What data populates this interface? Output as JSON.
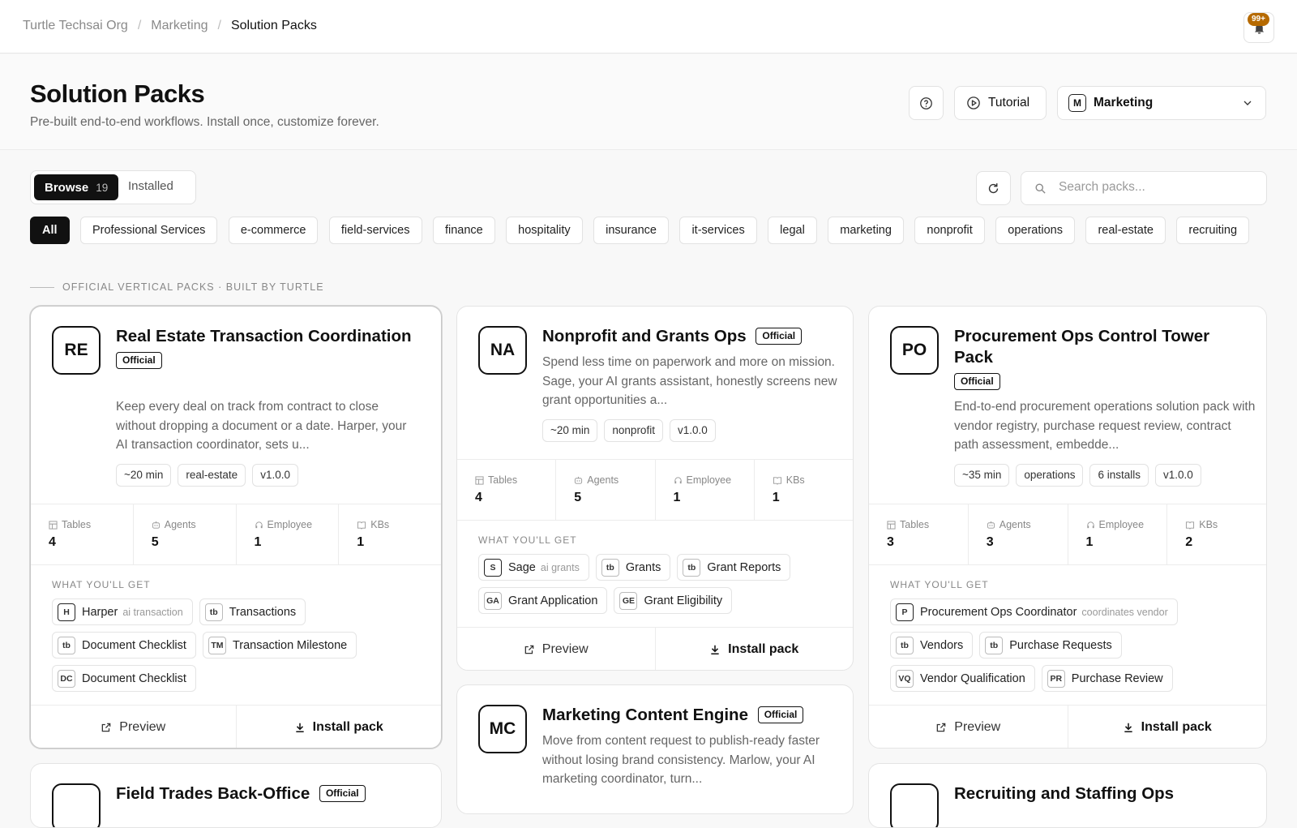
{
  "breadcrumb": [
    "Turtle Techsai Org",
    "Marketing",
    "Solution Packs"
  ],
  "notifications": {
    "badge": "99+"
  },
  "header": {
    "title": "Solution Packs",
    "subtitle": "Pre-built end-to-end workflows. Install once, customize forever.",
    "tutorial_label": "Tutorial",
    "workspace": {
      "initial": "M",
      "name": "Marketing"
    }
  },
  "tabs": {
    "browse": "Browse",
    "browse_count": "19",
    "installed": "Installed"
  },
  "search": {
    "placeholder": "Search packs..."
  },
  "filters": [
    "All",
    "Professional Services",
    "e-commerce",
    "field-services",
    "finance",
    "hospitality",
    "insurance",
    "it-services",
    "legal",
    "marketing",
    "nonprofit",
    "operations",
    "real-estate",
    "recruiting"
  ],
  "section_label": "OFFICIAL VERTICAL PACKS · BUILT BY TURTLE",
  "labels": {
    "official": "Official",
    "what_youll_get": "WHAT YOU'LL GET",
    "preview": "Preview",
    "install": "Install pack",
    "stats": [
      "Tables",
      "Agents",
      "Employee",
      "KBs"
    ]
  },
  "cards": [
    {
      "initials": "RE",
      "title": "Real Estate Transaction Coordination",
      "description": "Keep every deal on track from contract to close without dropping a document or a date. Harper, your AI transaction coordinator, sets u...",
      "meta": [
        "~20 min",
        "real-estate",
        "v1.0.0"
      ],
      "stats": [
        "4",
        "5",
        "1",
        "1"
      ],
      "items": [
        {
          "badge": "H",
          "label": "Harper",
          "sub": "ai transaction"
        },
        {
          "badge": "tb",
          "label": "Transactions"
        },
        {
          "badge": "tb",
          "label": "Document Checklist"
        },
        {
          "badge": "TM",
          "label": "Transaction Milestone"
        },
        {
          "badge": "DC",
          "label": "Document Checklist"
        }
      ]
    },
    {
      "initials": "NA",
      "title": "Nonprofit and Grants Ops",
      "description": "Spend less time on paperwork and more on mission. Sage, your AI grants assistant, honestly screens new grant opportunities a...",
      "meta": [
        "~20 min",
        "nonprofit",
        "v1.0.0"
      ],
      "stats": [
        "4",
        "5",
        "1",
        "1"
      ],
      "items": [
        {
          "badge": "S",
          "label": "Sage",
          "sub": "ai grants"
        },
        {
          "badge": "tb",
          "label": "Grants"
        },
        {
          "badge": "tb",
          "label": "Grant Reports"
        },
        {
          "badge": "GA",
          "label": "Grant Application"
        },
        {
          "badge": "GE",
          "label": "Grant Eligibility"
        }
      ]
    },
    {
      "initials": "PO",
      "title": "Procurement Ops Control Tower Pack",
      "description": "End-to-end procurement operations solution pack with vendor registry, purchase request review, contract path assessment, embedde...",
      "meta": [
        "~35 min",
        "operations",
        "6 installs",
        "v1.0.0"
      ],
      "stats": [
        "3",
        "3",
        "1",
        "2"
      ],
      "items": [
        {
          "badge": "P",
          "label": "Procurement Ops Coordinator",
          "sub": "coordinates vendor"
        },
        {
          "badge": "tb",
          "label": "Vendors"
        },
        {
          "badge": "tb",
          "label": "Purchase Requests"
        },
        {
          "badge": "VQ",
          "label": "Vendor Qualification"
        },
        {
          "badge": "PR",
          "label": "Purchase Review"
        }
      ]
    },
    {
      "initials": "MC",
      "title": "Marketing Content Engine",
      "description": "Move from content request to publish-ready faster without losing brand consistency. Marlow, your AI marketing coordinator, turn..."
    },
    {
      "initials": "",
      "title": "Field Trades Back-Office"
    },
    {
      "initials": "",
      "title": "Recruiting and Staffing Ops"
    }
  ]
}
